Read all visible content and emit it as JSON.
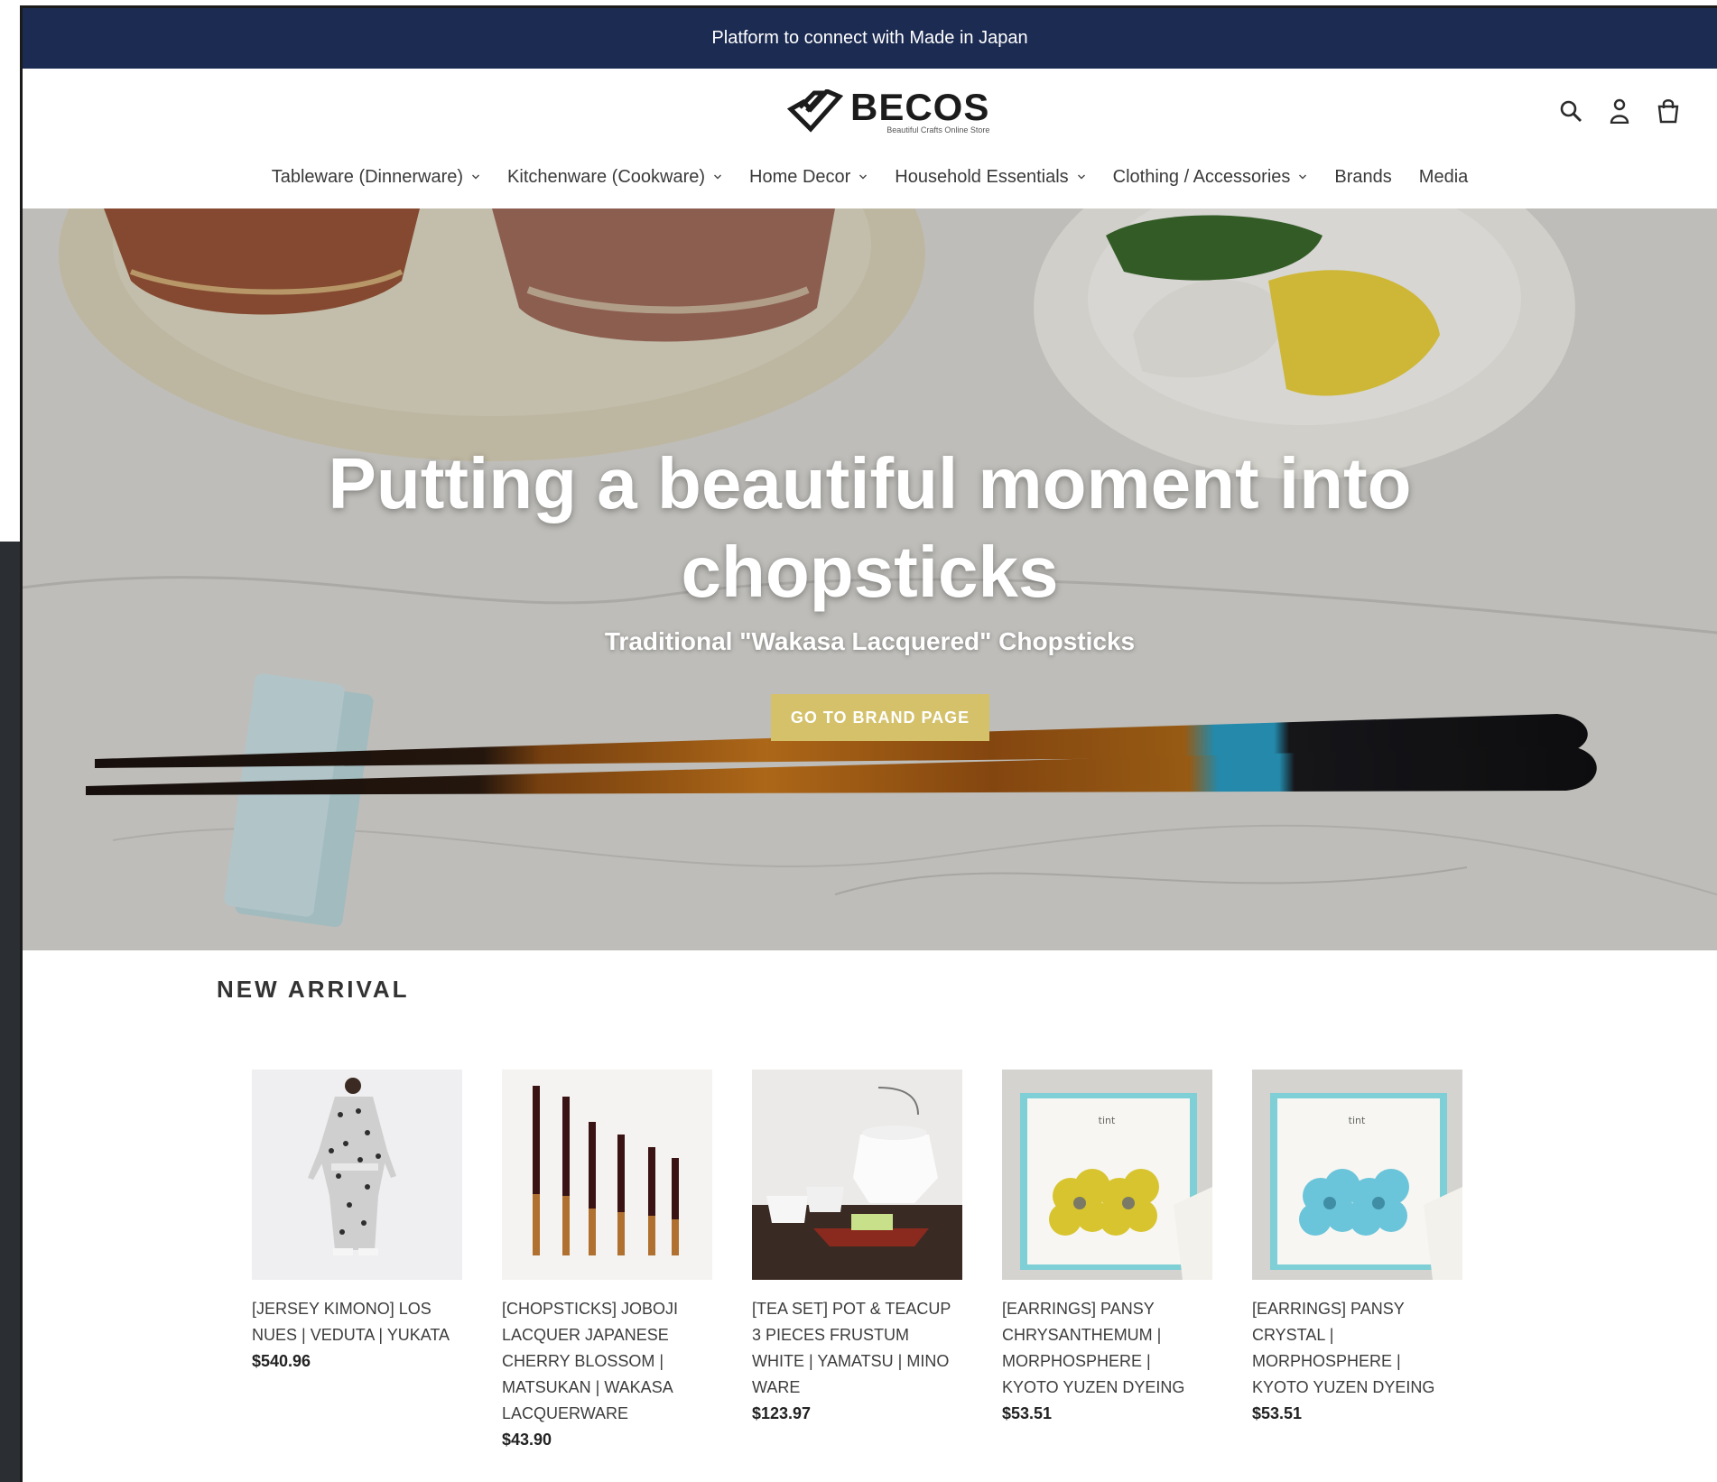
{
  "announcement": {
    "text": "Platform to connect with Made in Japan"
  },
  "header": {
    "logo_name": "BECOS",
    "logo_tagline": "Beautiful Crafts Online Store",
    "icons": [
      "search-icon",
      "account-icon",
      "cart-icon"
    ]
  },
  "nav": {
    "items": [
      {
        "label": "Tableware (Dinnerware)",
        "has_dropdown": true
      },
      {
        "label": "Kitchenware (Cookware)",
        "has_dropdown": true
      },
      {
        "label": "Home Decor",
        "has_dropdown": true
      },
      {
        "label": "Household Essentials",
        "has_dropdown": true
      },
      {
        "label": "Clothing / Accessories",
        "has_dropdown": true
      },
      {
        "label": "Brands",
        "has_dropdown": false
      },
      {
        "label": "Media",
        "has_dropdown": false
      }
    ]
  },
  "hero": {
    "title_line1": "Putting a beautiful moment into",
    "title_line2": "chopsticks",
    "subtitle": "Traditional \"Wakasa Lacquered\" Chopsticks",
    "button_label": "GO TO BRAND PAGE"
  },
  "new_arrival": {
    "title": "NEW ARRIVAL",
    "products": [
      {
        "name_lines": [
          "[JERSEY KIMONO] LOS",
          "NUES | VEDUTA | YUKATA"
        ],
        "price": "$540.96"
      },
      {
        "name_lines": [
          "[CHOPSTICKS] JOBOJI",
          "LACQUER JAPANESE",
          "CHERRY BLOSSOM |",
          "MATSUKAN | WAKASA",
          "LACQUERWARE"
        ],
        "price": "$43.90"
      },
      {
        "name_lines": [
          "[TEA SET] POT & TEACUP",
          "3 PIECES FRUSTUM",
          "WHITE | YAMATSU | MINO",
          "WARE"
        ],
        "price": "$123.97"
      },
      {
        "name_lines": [
          "[EARRINGS] PANSY",
          "CHRYSANTHEMUM |",
          "MORPHOSPHERE |",
          "KYOTO YUZEN DYEING"
        ],
        "price": "$53.51"
      },
      {
        "name_lines": [
          "[EARRINGS] PANSY",
          "CRYSTAL |",
          "MORPHOSPHERE |",
          "KYOTO YUZEN DYEING"
        ],
        "price": "$53.51"
      }
    ],
    "box_label": "tint"
  },
  "colors": {
    "announcement_bg": "#1c2b52",
    "hero_button_bg": "#d4c16a",
    "text": "#3a3a3a"
  }
}
